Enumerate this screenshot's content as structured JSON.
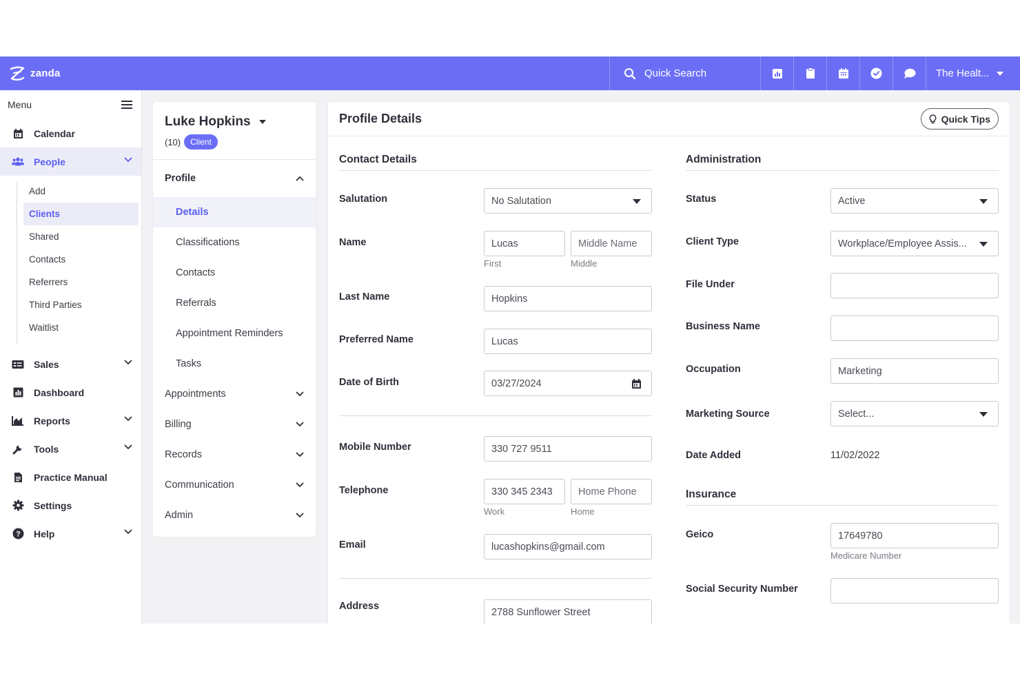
{
  "topbar": {
    "brand": "zanda",
    "search_label": "Quick Search",
    "icons": [
      "chart-icon",
      "clipboard-icon",
      "calendar-icon",
      "check-circle-icon",
      "chat-icon"
    ],
    "account_label": "The Healt..."
  },
  "sidebar": {
    "menu_label": "Menu",
    "items": {
      "calendar": "Calendar",
      "people": "People",
      "sales": "Sales",
      "dashboard": "Dashboard",
      "reports": "Reports",
      "tools": "Tools",
      "practice_manual": "Practice Manual",
      "settings": "Settings",
      "help": "Help"
    },
    "people_sub": [
      "Add",
      "Clients",
      "Shared",
      "Contacts",
      "Referrers",
      "Third Parties",
      "Waitlist"
    ]
  },
  "client": {
    "name": "Luke Hopkins",
    "count": "(10)",
    "badge": "Client"
  },
  "profile_nav": {
    "section": "Profile",
    "items": [
      "Details",
      "Classifications",
      "Contacts",
      "Referrals",
      "Appointment Reminders",
      "Tasks"
    ],
    "groups": [
      "Appointments",
      "Billing",
      "Records",
      "Communication",
      "Admin"
    ]
  },
  "main": {
    "title": "Profile Details",
    "quick_tips": "Quick Tips",
    "contact": {
      "title": "Contact Details",
      "salutation_label": "Salutation",
      "salutation_value": "No Salutation",
      "name_label": "Name",
      "first_value": "Lucas",
      "middle_placeholder": "Middle Name",
      "first_hint": "First",
      "middle_hint": "Middle",
      "last_name_label": "Last Name",
      "last_name_value": "Hopkins",
      "preferred_label": "Preferred Name",
      "preferred_value": "Lucas",
      "dob_label": "Date of Birth",
      "dob_value": "03/27/2024",
      "mobile_label": "Mobile Number",
      "mobile_value": "330 727 9511",
      "telephone_label": "Telephone",
      "work_value": "330 345 2343",
      "home_placeholder": "Home Phone",
      "work_hint": "Work",
      "home_hint": "Home",
      "email_label": "Email",
      "email_value": "lucashopkins@gmail.com",
      "address_label": "Address",
      "address_value": "2788 Sunflower Street"
    },
    "admin": {
      "title": "Administration",
      "status_label": "Status",
      "status_value": "Active",
      "client_type_label": "Client Type",
      "client_type_value": "Workplace/Employee Assis...",
      "file_under_label": "File Under",
      "business_name_label": "Business Name",
      "occupation_label": "Occupation",
      "occupation_value": "Marketing",
      "marketing_source_label": "Marketing Source",
      "marketing_source_value": "Select...",
      "date_added_label": "Date Added",
      "date_added_value": "11/02/2022"
    },
    "insurance": {
      "title": "Insurance",
      "geico_label": "Geico",
      "geico_value": "17649780",
      "geico_hint": "Medicare Number",
      "ssn_label": "Social Security Number"
    }
  },
  "colors": {
    "accent": "#6b6ef5",
    "active_bg": "#ececf8",
    "active_text": "#5b5ff0",
    "background": "#f2f2f5"
  }
}
